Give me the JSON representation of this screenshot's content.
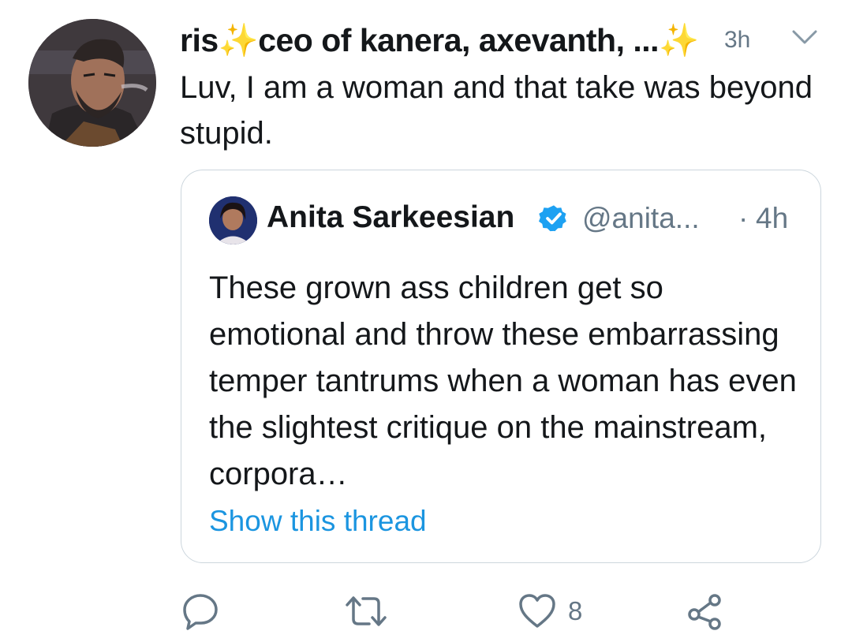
{
  "tweet": {
    "author_name": "ris✨ceo of kanera, axevanth, ...✨",
    "time": "3h",
    "text": "Luv, I am a woman and that take was beyond stupid.",
    "quoted": {
      "author_name": "Anita Sarkeesian",
      "verified": true,
      "handle": "@anita...",
      "dot": "·",
      "time": "4h",
      "text": "These grown ass children get so emotional and throw these embarrassing temper tantrums when a woman has even the slightest critique on the mainstream, corpora…",
      "show_thread": "Show this thread"
    },
    "actions": {
      "reply_icon": "reply-icon",
      "retweet_icon": "retweet-icon",
      "like_icon": "heart-icon",
      "like_count": "8",
      "share_icon": "share-icon"
    }
  },
  "colors": {
    "text": "#14171a",
    "secondary": "#657786",
    "link": "#1b95e0",
    "border": "#ccd6dd",
    "verified": "#1da1f2"
  }
}
